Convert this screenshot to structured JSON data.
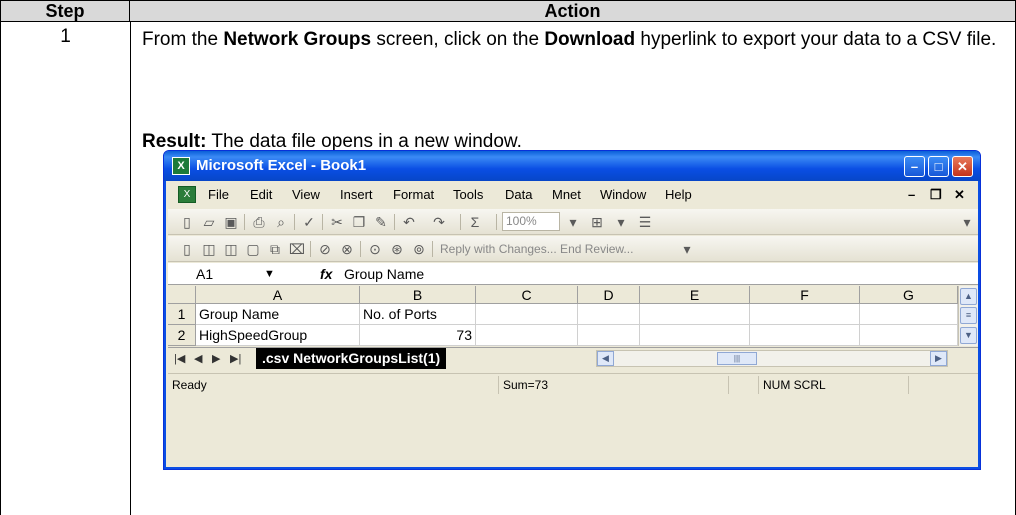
{
  "table": {
    "header_step": "Step",
    "header_action": "Action",
    "step_number": "1",
    "action_parts": [
      "From the ",
      "Network Groups",
      " screen, click on the ",
      "Download",
      " hyperlink to export your data to a CSV file."
    ],
    "result_label": "Result:",
    "result_text": "  The data file opens in a new window."
  },
  "excel": {
    "title": "Microsoft Excel - Book1",
    "menu": [
      "File",
      "Edit",
      "View",
      "Insert",
      "Format",
      "Tools",
      "Data",
      "Mnet",
      "Window",
      "Help"
    ],
    "zoom": "100%",
    "review_text": "Reply with Changes... End Review...",
    "name_box": "A1",
    "formula_value": "Group Name",
    "columns": [
      "A",
      "B",
      "C",
      "D",
      "E",
      "F",
      "G"
    ],
    "rows": [
      {
        "num": "1",
        "a": "Group Name",
        "b": "No. of Ports"
      },
      {
        "num": "2",
        "a": "HighSpeedGroup",
        "b": "73"
      }
    ],
    "sheet_tab": ".csv NetworkGroupsList(1)",
    "status": {
      "ready": "Ready",
      "sum": "Sum=73",
      "mode": "NUM SCRL"
    },
    "brand_color": "#0a4ee4"
  }
}
